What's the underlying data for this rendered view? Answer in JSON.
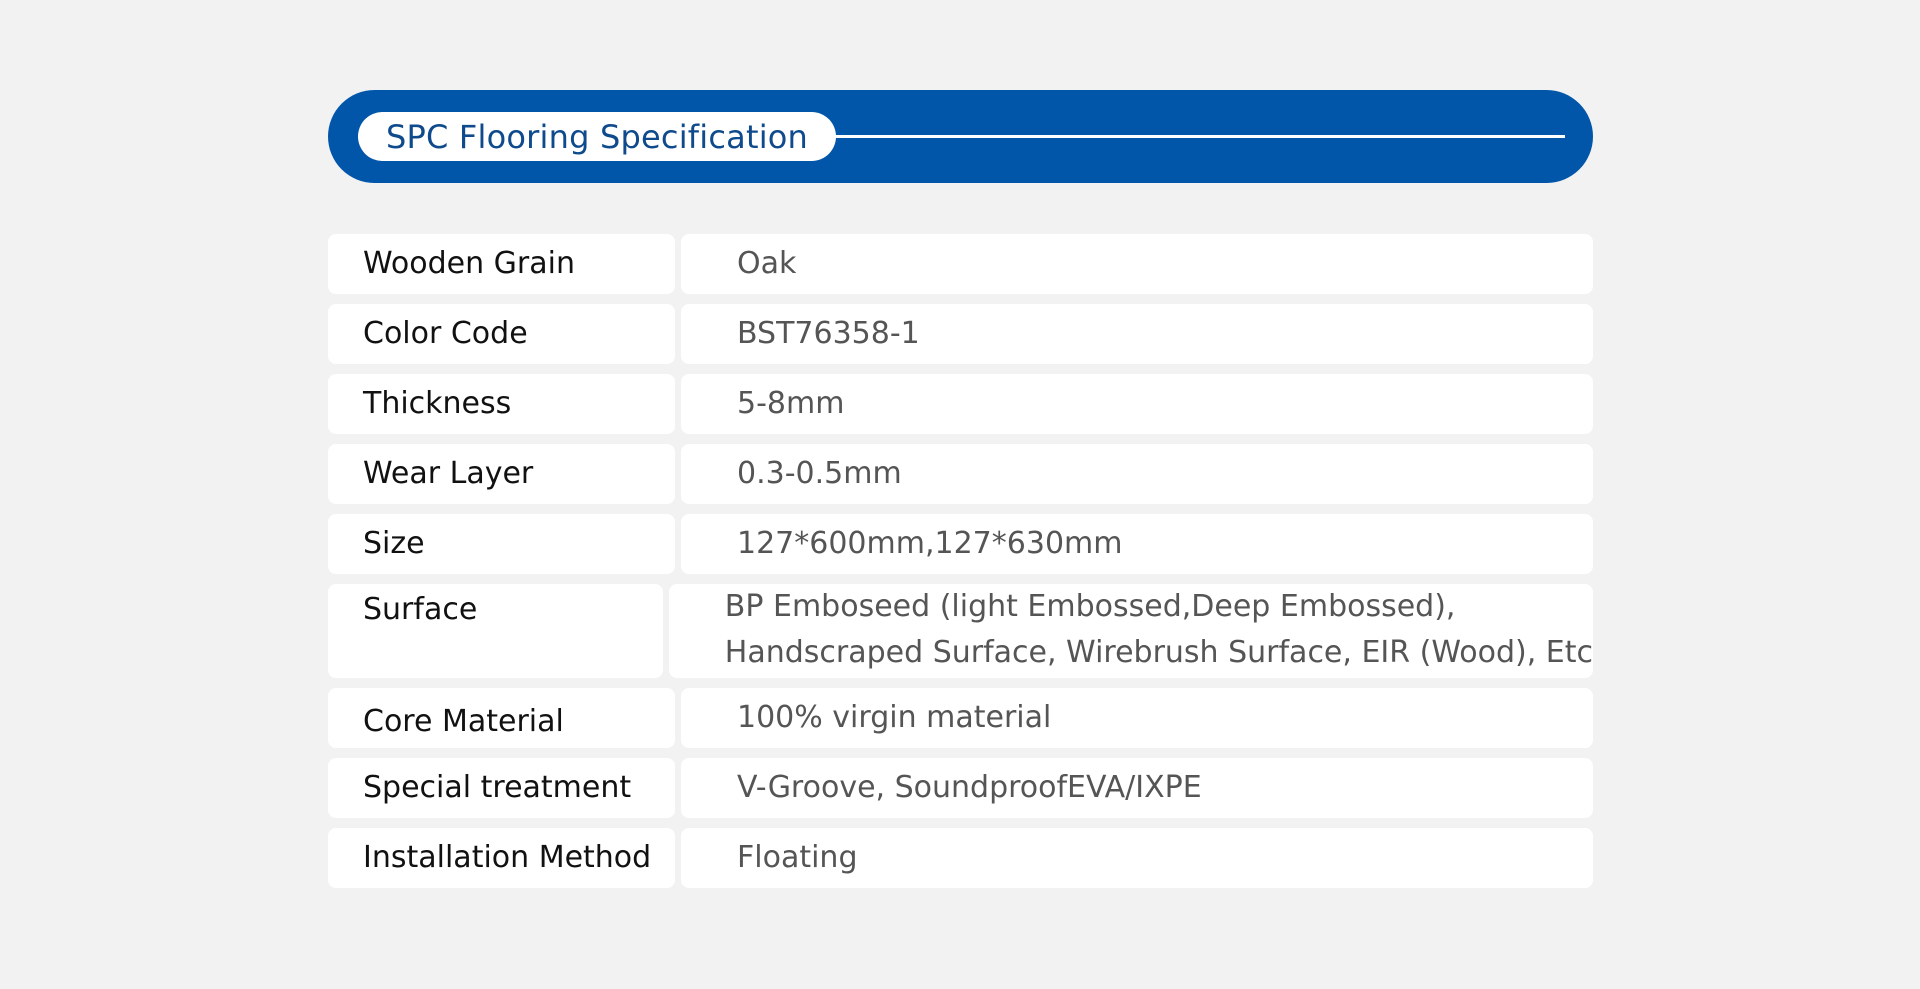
{
  "header": {
    "title": "SPC Flooring Specification"
  },
  "colors": {
    "banner_blue": "#0256a9",
    "title_text": "#0e4a8c",
    "background": "#f2f2f2"
  },
  "specs": [
    {
      "label": "Wooden Grain",
      "value": "Oak"
    },
    {
      "label": "Color Code",
      "value": "BST76358-1"
    },
    {
      "label": "Thickness",
      "value": "5-8mm"
    },
    {
      "label": "Wear Layer",
      "value": "0.3-0.5mm"
    },
    {
      "label": "Size",
      "value": "127*600mm,127*630mm"
    },
    {
      "label": "Surface",
      "value": "BP Emboseed (light Embossed,Deep Embossed),",
      "value2": "Handscraped Surface, Wirebrush Surface, EIR (Wood), Etc"
    },
    {
      "label": "Core Material",
      "value": "100% virgin material"
    },
    {
      "label": "Special treatment",
      "value": "V-Groove, SoundproofEVA/IXPE"
    },
    {
      "label": "Installation Method",
      "value": "Floating"
    }
  ]
}
